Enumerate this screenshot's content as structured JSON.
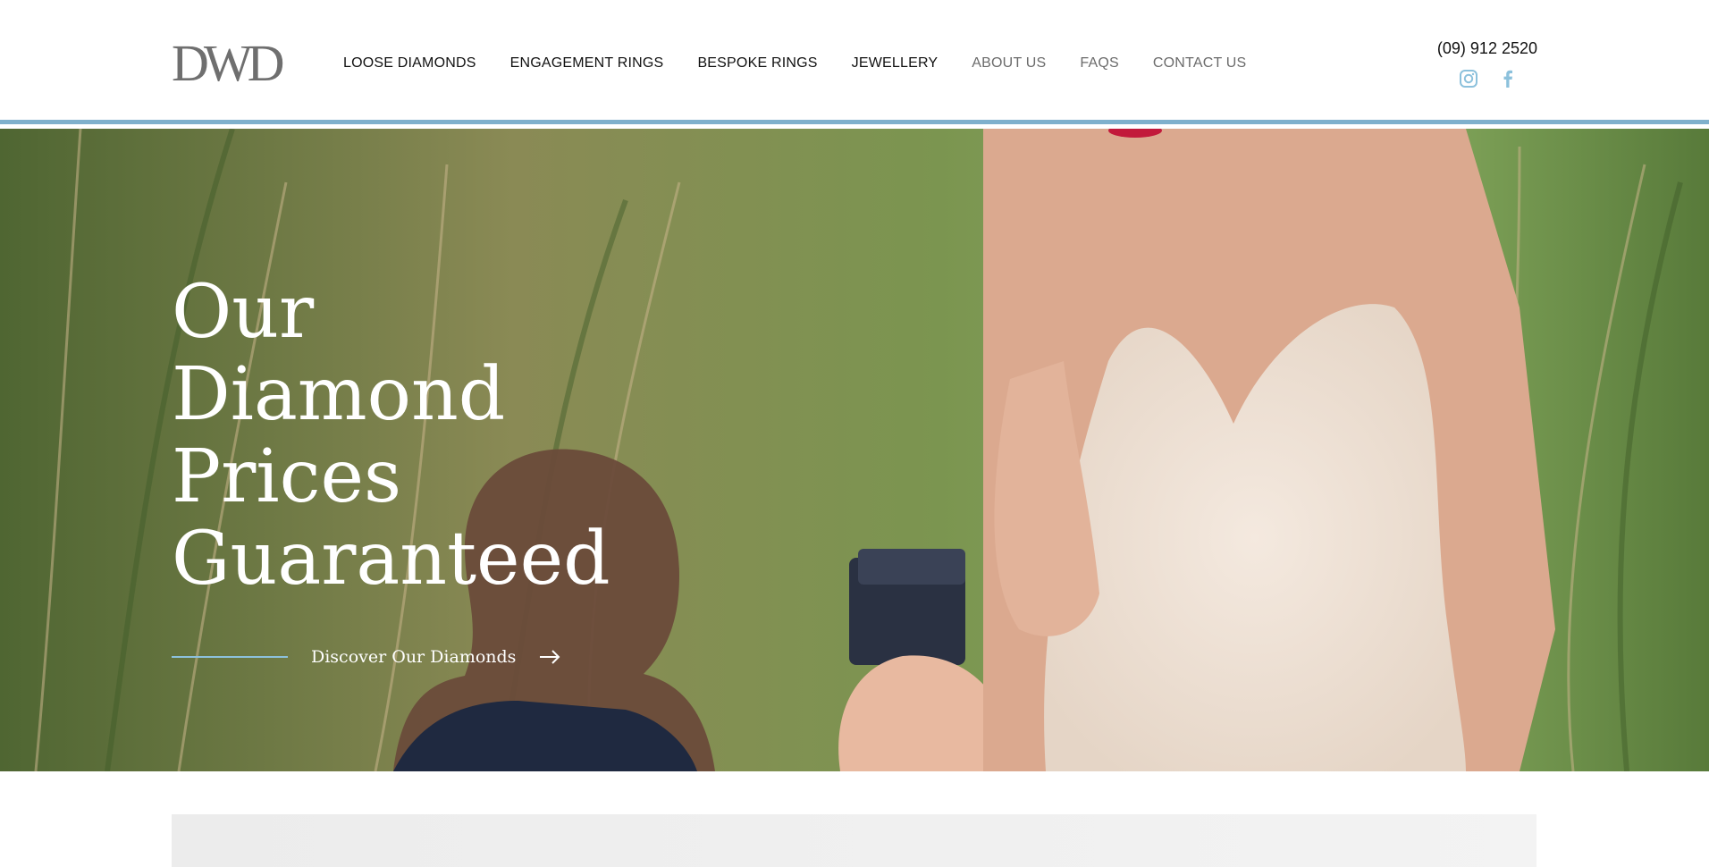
{
  "header": {
    "logo_text": "DWD",
    "nav": [
      {
        "label": "LOOSE DIAMONDS",
        "muted": false
      },
      {
        "label": "ENGAGEMENT RINGS",
        "muted": false
      },
      {
        "label": "BESPOKE RINGS",
        "muted": false
      },
      {
        "label": "JEWELLERY",
        "muted": false
      },
      {
        "label": "ABOUT US",
        "muted": true
      },
      {
        "label": "FAQS",
        "muted": true
      },
      {
        "label": "CONTACT US",
        "muted": true
      }
    ],
    "phone": "(09) 912 2520",
    "social": [
      "instagram-icon",
      "facebook-icon"
    ]
  },
  "hero": {
    "title_lines": [
      "Our",
      "Diamond",
      "Prices",
      "Guaranteed"
    ],
    "cta_label": "Discover Our Diamonds",
    "cta_icon": "arrow-right-icon"
  },
  "colors": {
    "accent": "#7fb0cc",
    "nav_text": "#111111",
    "nav_muted": "#6b6b6b",
    "hero_text": "#ffffff"
  }
}
